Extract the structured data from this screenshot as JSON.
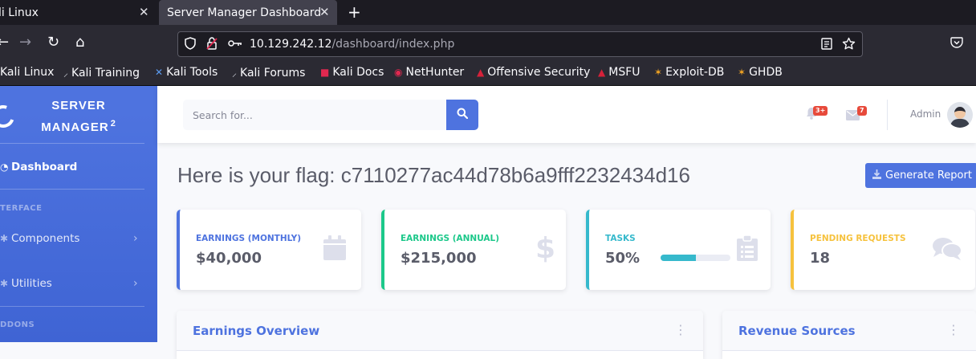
{
  "browser": {
    "tabs": [
      {
        "title": "li Linux",
        "close": "✕"
      },
      {
        "title": "Server Manager Dashboard",
        "close": "✕"
      }
    ],
    "new_tab": "+",
    "nav": {
      "back": "←",
      "forward": "→",
      "reload": "↻",
      "home": "⌂"
    },
    "url": {
      "host": "10.129.242.12",
      "path": "/dashboard/index.php"
    },
    "bookmarks": [
      {
        "label": "Kali Linux",
        "icon": "kali-icon"
      },
      {
        "label": "Kali Training",
        "icon": "kali-dragon-icon"
      },
      {
        "label": "Kali Tools",
        "icon": "kali-tools-icon"
      },
      {
        "label": "Kali Forums",
        "icon": "kali-dragon-icon"
      },
      {
        "label": "Kali Docs",
        "icon": "kali-docs-icon"
      },
      {
        "label": "NetHunter",
        "icon": "nethunter-icon"
      },
      {
        "label": "Offensive Security",
        "icon": "offsec-icon"
      },
      {
        "label": "MSFU",
        "icon": "offsec-icon"
      },
      {
        "label": "Exploit-DB",
        "icon": "exploitdb-icon"
      },
      {
        "label": "GHDB",
        "icon": "exploitdb-icon"
      }
    ]
  },
  "sidebar": {
    "brand_line1": "Server",
    "brand_line2": "Manager",
    "brand_sup": "2",
    "dashboard_label": "Dashboard",
    "heading_interface": "terface",
    "components_label": "Components",
    "utilities_label": "Utilities",
    "heading_addons": "ddons",
    "arrow": "›"
  },
  "topbar": {
    "search_placeholder": "Search for...",
    "alerts_badge": "3+",
    "messages_badge": "7",
    "user_name": "Admin"
  },
  "main": {
    "heading": "Here is your flag: c7110277ac44d78b6a9fff2232434d16",
    "report_button": "Generate Report"
  },
  "cards": [
    {
      "label": "Earnings (Monthly)",
      "value": "$40,000",
      "color": "#4e73df",
      "icon": "calendar-icon"
    },
    {
      "label": "Earnings (Annual)",
      "value": "$215,000",
      "color": "#1cc88a",
      "icon": "dollar-icon"
    },
    {
      "label": "Tasks",
      "value": "50%",
      "progress": 0.5,
      "color": "#36b9cc",
      "icon": "clipboard-icon"
    },
    {
      "label": "Pending Requests",
      "value": "18",
      "color": "#f6c23e",
      "icon": "comments-icon"
    }
  ],
  "panels": [
    {
      "title": "Earnings Overview"
    },
    {
      "title": "Revenue Sources"
    }
  ]
}
